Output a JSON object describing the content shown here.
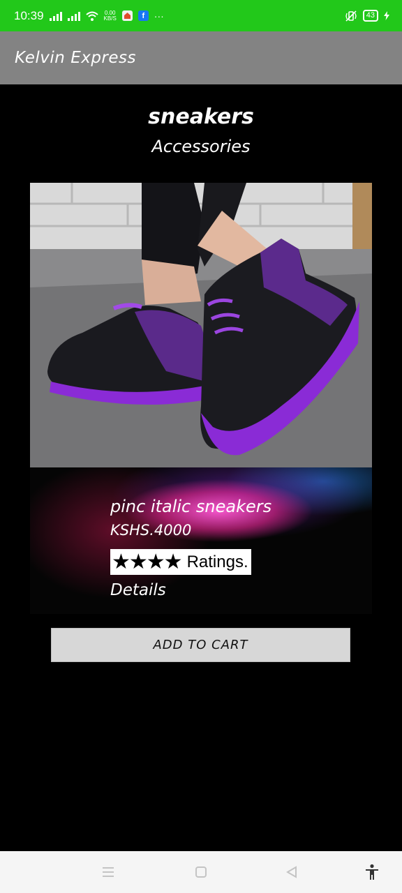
{
  "status_bar": {
    "time": "10:39",
    "speed_value": "0.00",
    "speed_unit": "KB/S",
    "battery": "43",
    "icons": [
      "signal-icon",
      "signal-icon",
      "wifi-icon",
      "notification-app-icon",
      "facebook-icon",
      "more-icon",
      "vibrate-icon",
      "battery-icon",
      "charging-icon"
    ]
  },
  "app_bar": {
    "title": "Kelvin Express"
  },
  "product": {
    "name": "sneakers",
    "category": "Accessories",
    "image_icon": "sneaker-photo"
  },
  "info": {
    "name": "pinc italic sneakers",
    "price": "KSHS.4000",
    "stars": "★★★★",
    "rating": 4,
    "ratings_label": "Ratings.",
    "details": "Details"
  },
  "actions": {
    "add_to_cart": "ADD TO CART"
  },
  "nav_bar": {
    "icons": [
      "menu-icon",
      "home-square-icon",
      "back-triangle-icon",
      "accessibility-icon"
    ]
  },
  "colors": {
    "status_bar": "#22c81a",
    "app_bar": "#838383",
    "background": "#000000",
    "button": "#d7d7d7",
    "shoe_accent": "#8a2bd6"
  }
}
